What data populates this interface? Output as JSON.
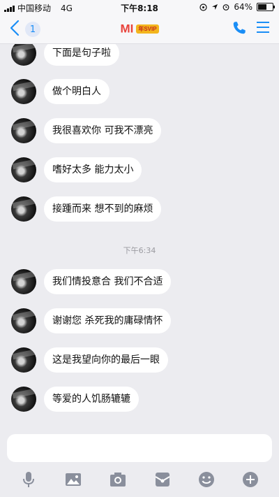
{
  "status_bar": {
    "carrier": "中国移动",
    "network": "4G",
    "time": "下午8:18",
    "battery_percent": "64%",
    "battery_level": 0.64
  },
  "nav": {
    "unread_count": "1",
    "title": "MI",
    "vip_badge": "年SVIP",
    "icons": [
      "back-chevron-icon",
      "phone-icon",
      "menu-icon"
    ],
    "accent_color": "#1a8ef6"
  },
  "messages": [
    {
      "text": "下面是句子啦"
    },
    {
      "text": "做个明白人"
    },
    {
      "text": "我很喜欢你 可我不漂亮"
    },
    {
      "text": "嗜好太多 能力太小"
    },
    {
      "text": "接踵而来  想不到的麻烦"
    },
    {
      "text": "我们情投意合 我们不合适"
    },
    {
      "text": "谢谢您 杀死我的庸碌情怀"
    },
    {
      "text": "这是我望向你的最后一眼"
    },
    {
      "text": "等爱的人饥肠辘辘"
    }
  ],
  "timestamp": "下午6:34",
  "input": {
    "placeholder": "",
    "tools": [
      "microphone-icon",
      "image-icon",
      "camera-icon",
      "red-packet-icon",
      "emoji-icon",
      "plus-icon"
    ]
  }
}
